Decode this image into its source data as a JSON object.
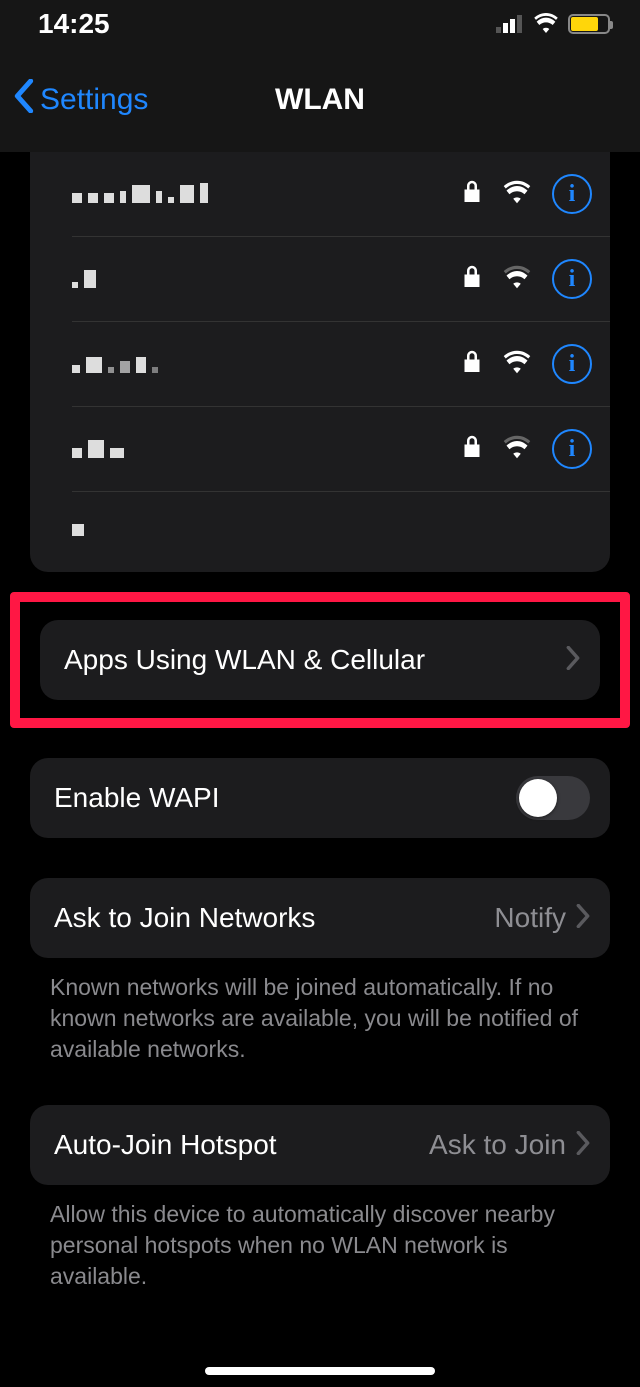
{
  "status": {
    "time": "14:25"
  },
  "nav": {
    "back_label": "Settings",
    "title": "WLAN"
  },
  "apps_cell": {
    "label": "Apps Using WLAN & Cellular"
  },
  "wapi": {
    "label": "Enable WAPI",
    "on": false
  },
  "ask_join": {
    "label": "Ask to Join Networks",
    "value": "Notify",
    "footer": "Known networks will be joined automatically. If no known networks are available, you will be notified of available networks."
  },
  "auto_hotspot": {
    "label": "Auto-Join Hotspot",
    "value": "Ask to Join",
    "footer": "Allow this device to automatically discover nearby personal hotspots when no WLAN network is available."
  }
}
